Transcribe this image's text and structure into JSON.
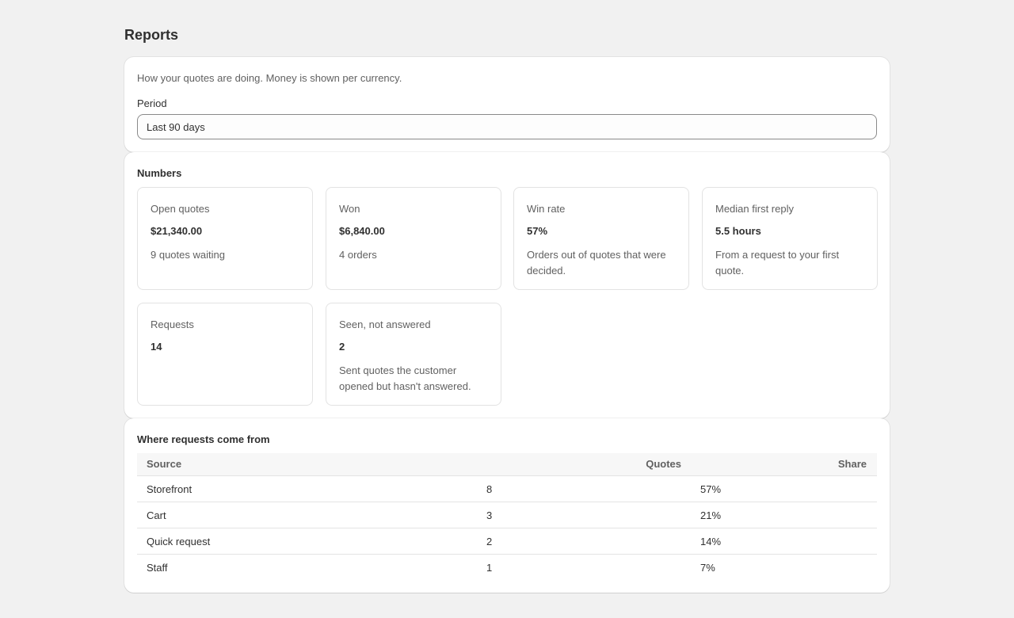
{
  "page": {
    "title": "Reports"
  },
  "period_card": {
    "intro": "How your quotes are doing. Money is shown per currency.",
    "period_label": "Period",
    "period_value": "Last 90 days"
  },
  "numbers": {
    "heading": "Numbers",
    "metrics": [
      {
        "label": "Open quotes",
        "value": "$21,340.00",
        "note": "9 quotes waiting"
      },
      {
        "label": "Won",
        "value": "$6,840.00",
        "note": "4 orders"
      },
      {
        "label": "Win rate",
        "value": "57%",
        "note": "Orders out of quotes that were decided."
      },
      {
        "label": "Median first reply",
        "value": "5.5 hours",
        "note": "From a request to your first quote."
      },
      {
        "label": "Requests",
        "value": "14",
        "note": ""
      },
      {
        "label": "Seen, not answered",
        "value": "2",
        "note": "Sent quotes the customer opened but hasn't answered."
      }
    ]
  },
  "sources": {
    "heading": "Where requests come from",
    "columns": {
      "source": "Source",
      "quotes": "Quotes",
      "share": "Share"
    },
    "rows": [
      {
        "source": "Storefront",
        "quotes": "8",
        "share": "57%"
      },
      {
        "source": "Cart",
        "quotes": "3",
        "share": "21%"
      },
      {
        "source": "Quick request",
        "quotes": "2",
        "share": "14%"
      },
      {
        "source": "Staff",
        "quotes": "1",
        "share": "7%"
      }
    ]
  }
}
